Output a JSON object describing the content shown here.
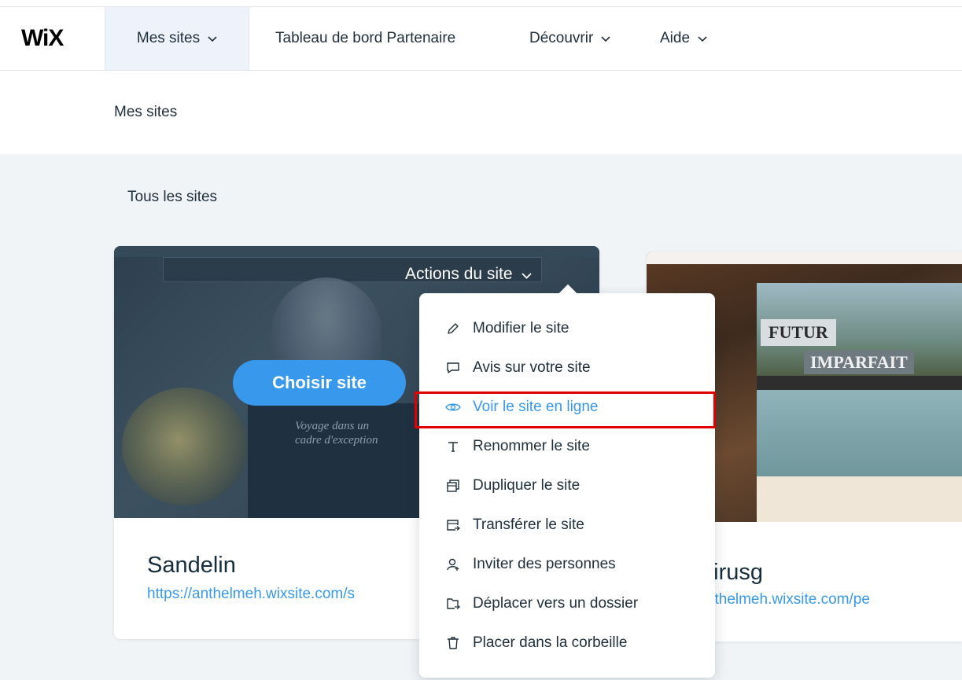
{
  "header": {
    "logo": "WiX",
    "nav": [
      {
        "label": "Mes sites",
        "has_chevron": true,
        "active": true
      },
      {
        "label": "Tableau de bord Partenaire",
        "has_chevron": false
      },
      {
        "label": "Découvrir",
        "has_chevron": true
      },
      {
        "label": "Aide",
        "has_chevron": true
      }
    ]
  },
  "breadcrumb": "Mes sites",
  "section_title": "Tous les sites",
  "sites": [
    {
      "name": "Sandelin",
      "url": "https://anthelmeh.wixsite.com/s",
      "actions_label": "Actions du site",
      "choose_label": "Choisir site",
      "thumb_caption": "Voyage dans un\ncadre d'exception"
    },
    {
      "name": "osvirusg",
      "url": "s://anthelmeh.wixsite.com/pe",
      "thumb_title_1": "FUTUR",
      "thumb_title_2": "IMPARFAIT"
    }
  ],
  "dropdown": {
    "items": [
      {
        "label": "Modifier le site",
        "icon": "pencil-icon"
      },
      {
        "label": "Avis sur votre site",
        "icon": "speech-bubble-icon"
      },
      {
        "label": "Voir le site en ligne",
        "icon": "eye-icon",
        "active": true
      },
      {
        "label": "Renommer le site",
        "icon": "text-t-icon"
      },
      {
        "label": "Dupliquer le site",
        "icon": "duplicate-icon"
      },
      {
        "label": "Transférer le site",
        "icon": "transfer-icon"
      },
      {
        "label": "Inviter des personnes",
        "icon": "invite-person-icon"
      },
      {
        "label": "Déplacer vers un dossier",
        "icon": "folder-move-icon"
      },
      {
        "label": "Placer dans la corbeille",
        "icon": "trash-icon"
      }
    ]
  },
  "colors": {
    "accent": "#3899ec",
    "text": "#20303c",
    "background": "#f0f4f7",
    "highlight": "#e00000"
  }
}
